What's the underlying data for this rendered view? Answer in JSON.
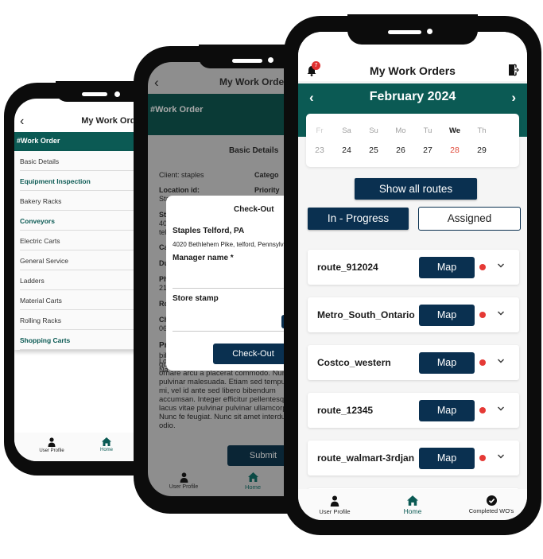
{
  "phone_left": {
    "header": {
      "title": "My Work Orders"
    },
    "section_band": "#Work Order",
    "list": [
      {
        "label": "Basic Details",
        "type": "item"
      },
      {
        "label": "Equipment Inspection",
        "type": "category"
      },
      {
        "label": "Bakery Racks",
        "type": "item"
      },
      {
        "label": "Conveyors",
        "type": "category"
      },
      {
        "label": "Electric Carts",
        "type": "item"
      },
      {
        "label": "General Service",
        "type": "item"
      },
      {
        "label": "Ladders",
        "type": "item"
      },
      {
        "label": "Material Carts",
        "type": "item"
      },
      {
        "label": "Rolling Racks",
        "type": "item"
      },
      {
        "label": "Shopping Carts",
        "type": "category"
      }
    ],
    "nav": {
      "user_profile": "User Profile",
      "home": "Home"
    }
  },
  "phone_middle": {
    "header": {
      "title": "My Work Orders"
    },
    "section_band": "#Work Order",
    "basic_details_heading": "Basic Details",
    "fields": {
      "client": "Client: staples",
      "category": "Catego",
      "location_label": "Location id:",
      "location_value": "Staples Telford, PA",
      "priority": "Priority",
      "st": "St",
      "st_value": "40",
      "st_value2": "tel",
      "ca": "Ca",
      "du": "Du",
      "ph": "Ph",
      "ph_value": "21",
      "ro": "Ro",
      "ch": "Ch",
      "ch_value": "06",
      "pr": "Pr",
      "lo": "Lo",
      "na": "Na"
    },
    "lorem": "bibendum mi. Nunc viverra et mauris quis. Fusce ac volutpat enim. Nulla ac ornare arcu a placerat commodo. Nunc pulvinar malesuada. Etiam sed tempus mi, vel id ante sed libero bibendum accumsan. Integer efficitur pellentesque lacus vitae pulvinar pulvinar ullamcorper. Nunc fe feugiat. Nunc sit amet interdum odio.",
    "submit_label": "Submit",
    "modal": {
      "title": "Check-Out",
      "store_name": "Staples Telford, PA",
      "address": "4020 Bethlehem Pike, telford, Pennsylvania",
      "manager_label": "Manager name *",
      "manager_value": "",
      "stamp_label": "Store stamp",
      "button_label": "Check-Out"
    },
    "nav": {
      "user_profile": "User Profile",
      "home": "Home"
    }
  },
  "phone_right": {
    "header": {
      "title": "My Work Orders",
      "notification_count": "7"
    },
    "calendar": {
      "month_label": "February 2024",
      "days": [
        {
          "dow": "Fr",
          "date": "23",
          "state": "disabled"
        },
        {
          "dow": "Sa",
          "date": "24",
          "state": "normal"
        },
        {
          "dow": "Su",
          "date": "25",
          "state": "normal"
        },
        {
          "dow": "Mo",
          "date": "26",
          "state": "normal"
        },
        {
          "dow": "Tu",
          "date": "27",
          "state": "normal"
        },
        {
          "dow": "We",
          "date": "28",
          "state": "today"
        },
        {
          "dow": "Th",
          "date": "29",
          "state": "normal"
        }
      ]
    },
    "show_all_label": "Show all routes",
    "tabs": {
      "in_progress": "In - Progress",
      "assigned": "Assigned",
      "active": "in_progress"
    },
    "routes": [
      {
        "name": "route_912024",
        "map_label": "Map",
        "status_color": "#e53935"
      },
      {
        "name": "Metro_South_Ontario",
        "map_label": "Map",
        "status_color": "#e53935"
      },
      {
        "name": "Costco_western",
        "map_label": "Map",
        "status_color": "#e53935"
      },
      {
        "name": "route_12345",
        "map_label": "Map",
        "status_color": "#e53935"
      },
      {
        "name": "route_walmart-3rdjan",
        "map_label": "Map",
        "status_color": "#e53935"
      }
    ],
    "nav": {
      "user_profile": "User Profile",
      "home": "Home",
      "completed": "Completed WO's"
    }
  },
  "colors": {
    "brand_teal": "#0b5a54",
    "brand_navy": "#0a3050",
    "status_red": "#e53935",
    "today_red": "#e04a3a"
  }
}
